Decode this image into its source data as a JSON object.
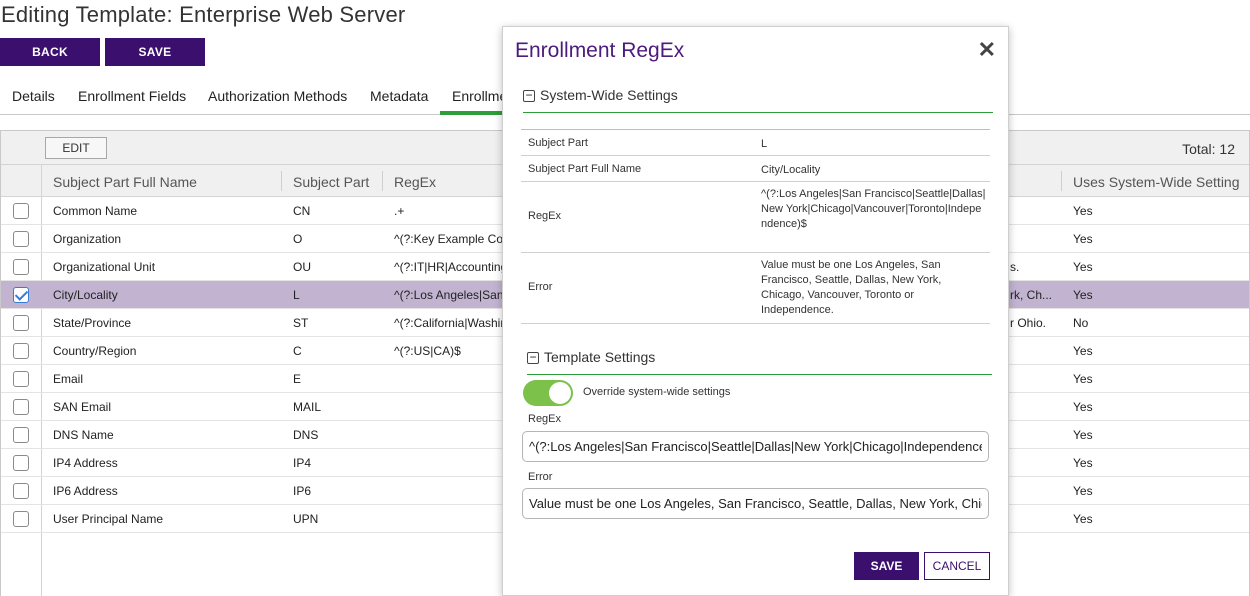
{
  "page": {
    "title": "Editing Template: Enterprise Web Server"
  },
  "actions": {
    "back": "BACK",
    "save": "SAVE"
  },
  "tabs": [
    {
      "label": "Details"
    },
    {
      "label": "Enrollment Fields"
    },
    {
      "label": "Authorization Methods"
    },
    {
      "label": "Metadata"
    },
    {
      "label": "Enrollme"
    }
  ],
  "grid": {
    "edit_label": "EDIT",
    "total": "Total: 12",
    "columns": [
      "Subject Part Full Name",
      "Subject Part",
      "RegEx",
      "Uses System-Wide Setting"
    ],
    "rows": [
      {
        "name": "Common Name",
        "part": "CN",
        "regex": ".+",
        "error": "",
        "uses": "Yes",
        "checked": false
      },
      {
        "name": "Organization",
        "part": "O",
        "regex": "^(?:Key Example Com",
        "error": "",
        "uses": "Yes",
        "checked": false
      },
      {
        "name": "Organizational Unit",
        "part": "OU",
        "regex": "^(?:IT|HR|Accounting",
        "error": "s.",
        "uses": "Yes",
        "checked": false
      },
      {
        "name": "City/Locality",
        "part": "L",
        "regex": "^(?:Los Angeles|San",
        "error": "rk, Ch...",
        "uses": "Yes",
        "checked": true
      },
      {
        "name": "State/Province",
        "part": "ST",
        "regex": "^(?:California|Washin",
        "error": "r Ohio.",
        "uses": "No",
        "checked": false
      },
      {
        "name": "Country/Region",
        "part": "C",
        "regex": "^(?:US|CA)$",
        "error": "",
        "uses": "Yes",
        "checked": false
      },
      {
        "name": "Email",
        "part": "E",
        "regex": "",
        "error": "",
        "uses": "Yes",
        "checked": false
      },
      {
        "name": "SAN Email",
        "part": "MAIL",
        "regex": "",
        "error": "",
        "uses": "Yes",
        "checked": false
      },
      {
        "name": "DNS Name",
        "part": "DNS",
        "regex": "",
        "error": "",
        "uses": "Yes",
        "checked": false
      },
      {
        "name": "IP4 Address",
        "part": "IP4",
        "regex": "",
        "error": "",
        "uses": "Yes",
        "checked": false
      },
      {
        "name": "IP6 Address",
        "part": "IP6",
        "regex": "",
        "error": "",
        "uses": "Yes",
        "checked": false
      },
      {
        "name": "User Principal Name",
        "part": "UPN",
        "regex": "",
        "error": "",
        "uses": "Yes",
        "checked": false
      }
    ]
  },
  "modal": {
    "title": "Enrollment RegEx",
    "close_icon": "close-icon",
    "system_section": "System-Wide Settings",
    "system_rows": [
      {
        "key": "Subject Part",
        "value": "L"
      },
      {
        "key": "Subject Part Full Name",
        "value": "City/Locality"
      },
      {
        "key": "RegEx",
        "value": "^(?:Los Angeles|San Francisco|Seattle|Dallas|New York|Chicago|Vancouver|Toronto|Independence)$"
      },
      {
        "key": "Error",
        "value": "Value must be one Los Angeles, San Francisco, Seattle, Dallas, New York, Chicago, Vancouver, Toronto or Independence."
      }
    ],
    "template_section": "Template Settings",
    "override_label": "Override system-wide settings",
    "override_on": true,
    "regex_label": "RegEx",
    "regex_value": "^(?:Los Angeles|San Francisco|Seattle|Dallas|New York|Chicago|Independence",
    "error_label": "Error",
    "error_value": "Value must be one Los Angeles, San Francisco, Seattle, Dallas, New York, Chic",
    "save": "SAVE",
    "cancel": "CANCEL"
  },
  "colors": {
    "brand": "#3b0f6e",
    "accent_green": "#2e9e3a",
    "toggle_on": "#7cc14a",
    "selected_row": "#c2b4d1"
  }
}
